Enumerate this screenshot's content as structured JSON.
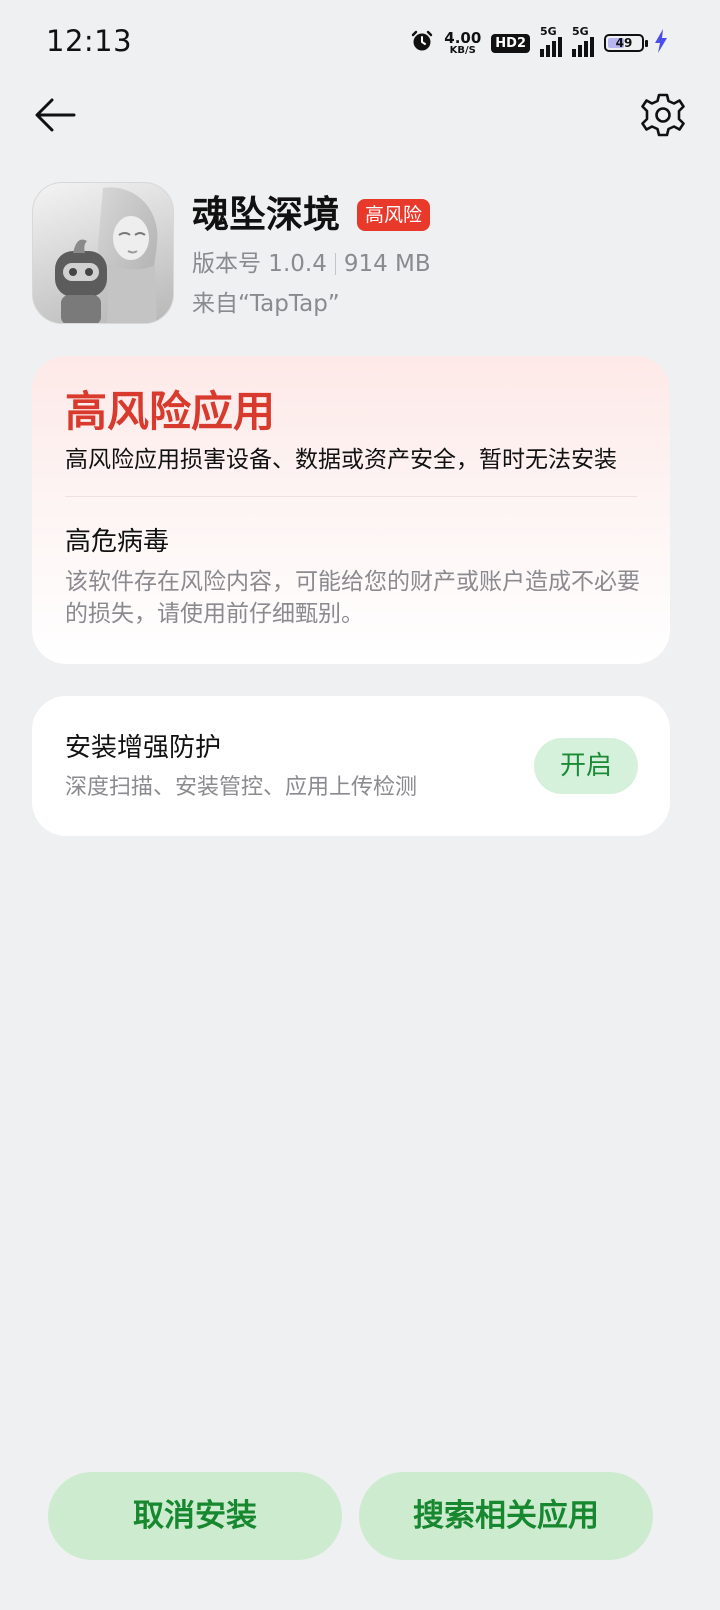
{
  "status_bar": {
    "time": "12:13",
    "net_speed_value": "4.00",
    "net_speed_unit": "KB/S",
    "hd_label": "HD2",
    "signal1_label": "5G",
    "signal2_label": "5G",
    "battery_level": "49",
    "battery_fraction": 0.49,
    "icons": [
      "alarm-icon",
      "hd-icon",
      "signal-icon",
      "signal-icon",
      "battery-icon",
      "charging-icon"
    ]
  },
  "header": {
    "back_icon": "arrow-left-icon",
    "settings_icon": "gear-icon"
  },
  "app": {
    "name": "魂坠深境",
    "risk_badge": "高风险",
    "version": "版本号 1.0.4",
    "size": "914 MB",
    "source": "来自“TapTap”"
  },
  "warning": {
    "title": "高风险应用",
    "description": "高风险应用损害设备、数据或资产安全，暂时无法安装",
    "virus_title": "高危病毒",
    "virus_description": "该软件存在风险内容，可能给您的财产或账户造成不必要的损失，请使用前仔细甄别。"
  },
  "protection": {
    "title": "安装增强防护",
    "description": "深度扫描、安装管控、应用上传检测",
    "button": "开启"
  },
  "actions": {
    "cancel": "取消安装",
    "search": "搜索相关应用"
  },
  "colors": {
    "background": "#eff0f2",
    "risk_red": "#d83a2e",
    "badge_red": "#e8392b",
    "accent_green": "#17882f",
    "button_green_bg": "#cdeccf"
  }
}
